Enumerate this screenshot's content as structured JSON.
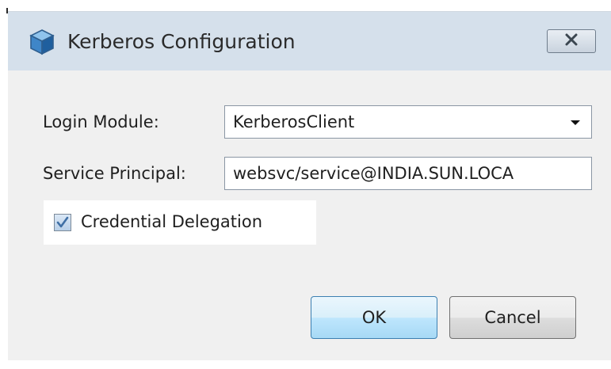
{
  "window": {
    "title": "Kerberos Configuration",
    "icon": "cube-icon",
    "close_icon": "close-x-icon"
  },
  "form": {
    "login_module": {
      "label": "Login Module:",
      "value": "KerberosClient",
      "dropdown_icon": "chevron-down-icon"
    },
    "service_principal": {
      "label": "Service Principal:",
      "value": "websvc/service@INDIA.SUN.LOCA"
    },
    "credential_delegation": {
      "label": "Credential Delegation",
      "checked": true
    }
  },
  "buttons": {
    "ok_label": "OK",
    "cancel_label": "Cancel"
  },
  "colors": {
    "titlebar": "#d5e0eb",
    "dialog_background": "#f0f0f0",
    "ok_border": "#3c7fb1",
    "check_mark": "#3f6fa5"
  }
}
